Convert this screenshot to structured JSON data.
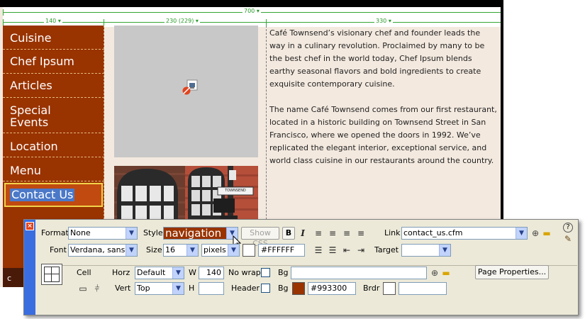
{
  "rulers": {
    "table_width": "700",
    "col1_width": "140",
    "col2_width": "230 (229)",
    "col3_width": "330"
  },
  "nav": {
    "items": [
      "Cuisine",
      "Chef Ipsum",
      "Articles",
      "Special Events",
      "Location",
      "Menu",
      "Contact Us"
    ],
    "bottom_fragment": "c"
  },
  "content": {
    "paragraph1": "Café Townsend’s visionary chef and founder leads the way in a culinary revolution. Proclaimed by many to be the best chef in the world today, Chef Ipsum blends earthy seasonal flavors and bold ingredients to create exquisite contemporary cuisine.",
    "paragraph2": "The name Café Townsend comes from our first restaurant, located in a historic building on Townsend Street in San Francisco, where we opened the doors in 1992. We’ve replicated the elegant interior, exceptional service, and world class cuisine in our restaurants around the country.",
    "photo_sign": "TOWNSEND"
  },
  "inspector": {
    "format_label": "Format",
    "format_value": "None",
    "style_label": "Style",
    "style_value": "navigation",
    "show_css_label": "Show CSS",
    "bold_label": "B",
    "italic_label": "I",
    "link_label": "Link",
    "link_value": "contact_us.cfm",
    "font_label": "Font",
    "font_value": "Verdana, sans-serif",
    "size_label": "Size",
    "size_value": "16",
    "size_unit": "pixels",
    "text_color_value": "#FFFFFF",
    "target_label": "Target",
    "target_value": "",
    "cell_label": "Cell",
    "horz_label": "Horz",
    "horz_value": "Default",
    "w_label": "W",
    "w_value": "140",
    "nowrap_label": "No wrap",
    "bg_label": "Bg",
    "bg_image_value": "",
    "page_properties_label": "Page Properties...",
    "vert_label": "Vert",
    "vert_value": "Top",
    "h_label": "H",
    "h_value": "",
    "header_label": "Header",
    "bg_color_label": "Bg",
    "bg_color_value": "#993300",
    "brdr_label": "Brdr",
    "brdr_value": "",
    "help_glyph": "?"
  },
  "colors": {
    "nav_bg": "#993300",
    "page_bg": "#f3e9df",
    "style_box": "#993300",
    "inspector_bg": "#ece9d8",
    "accent_blue": "#3a6de0"
  }
}
